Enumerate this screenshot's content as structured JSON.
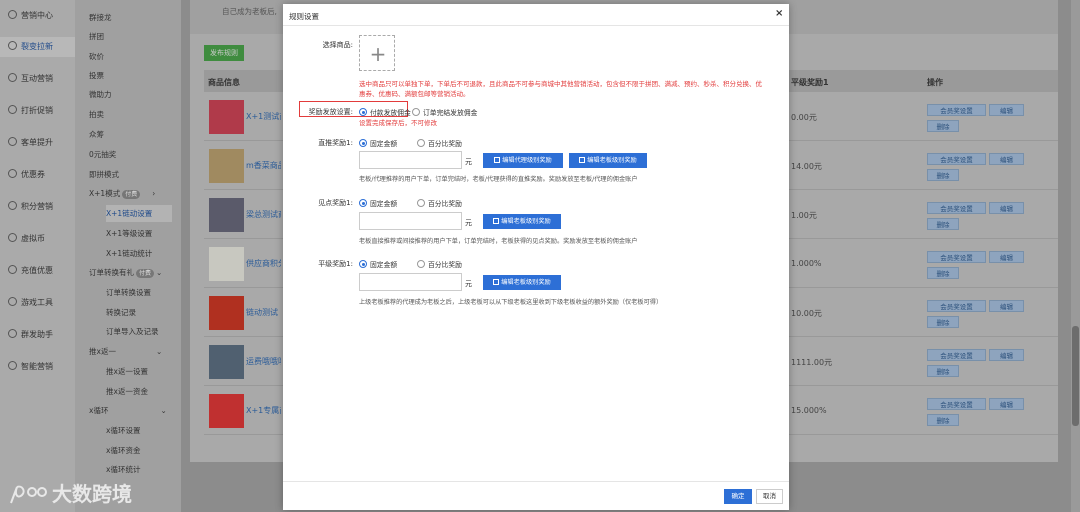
{
  "left_nav": [
    {
      "label": "营销中心",
      "icon": "target-icon"
    },
    {
      "label": "裂变拉新",
      "icon": "fission-icon"
    },
    {
      "label": "互动营销",
      "icon": "interaction-icon"
    },
    {
      "label": "打折促销",
      "icon": "discount-icon"
    },
    {
      "label": "客单提升",
      "icon": "growth-icon"
    },
    {
      "label": "优惠券",
      "icon": "coupon-icon"
    },
    {
      "label": "积分营销",
      "icon": "points-icon"
    },
    {
      "label": "虚拟币",
      "icon": "coin-icon"
    },
    {
      "label": "充值优惠",
      "icon": "recharge-icon"
    },
    {
      "label": "游戏工具",
      "icon": "game-icon"
    },
    {
      "label": "群发助手",
      "icon": "broadcast-icon"
    },
    {
      "label": "智能营销",
      "icon": "smart-icon"
    }
  ],
  "sub_nav": [
    {
      "label": "群接龙",
      "level": 1
    },
    {
      "label": "拼团",
      "level": 1
    },
    {
      "label": "砍价",
      "level": 1
    },
    {
      "label": "投票",
      "level": 1
    },
    {
      "label": "微助力",
      "level": 1
    },
    {
      "label": "拍卖",
      "level": 1
    },
    {
      "label": "众筹",
      "level": 1
    },
    {
      "label": "0元抽奖",
      "level": 1
    },
    {
      "label": "即拼模式",
      "level": 1
    },
    {
      "label": "X+1模式",
      "level": 1,
      "badge": "付费"
    },
    {
      "label": "X+1链动设置",
      "level": 2,
      "active": true
    },
    {
      "label": "X+1等级设置",
      "level": 2
    },
    {
      "label": "X+1链动统计",
      "level": 2
    },
    {
      "label": "订单转换有礼",
      "level": 1,
      "badge": "付费"
    },
    {
      "label": "订单转换设置",
      "level": 2
    },
    {
      "label": "转换记录",
      "level": 2
    },
    {
      "label": "订单导入及记录",
      "level": 2
    },
    {
      "label": "推x返一",
      "level": 1
    },
    {
      "label": "推x返一设置",
      "level": 2
    },
    {
      "label": "推x返一资金",
      "level": 2
    },
    {
      "label": "x循环",
      "level": 1
    },
    {
      "label": "x循环设置",
      "level": 2
    },
    {
      "label": "x循环资金",
      "level": 2
    },
    {
      "label": "x循环统计",
      "level": 2
    }
  ],
  "main": {
    "top_text": "自己成为老板后,",
    "publish_label": "发布规则",
    "col_product": "商品信息",
    "col_reward": "平级奖励1",
    "col_action": "操作",
    "btn_setting": "会员奖设置",
    "btn_edit": "编辑",
    "btn_delete": "删除",
    "rows": [
      {
        "name": "X+1测试商品",
        "reward": "0.00元",
        "thumb_color": "#b03a4a"
      },
      {
        "name": "m香菜商品觉得就到哪",
        "reward": "14.00元",
        "thumb_color": "#a08a60"
      },
      {
        "name": "梁总测试商品",
        "reward": "1.00元",
        "thumb_color": "#5a5a6a"
      },
      {
        "name": "供应商积分",
        "reward": "1.000%",
        "thumb_color": "#c8c8c0"
      },
      {
        "name": "链动测试",
        "reward": "10.00元",
        "thumb_color": "#b03020"
      },
      {
        "name": "运费哦哦哦哦趣哦哦返",
        "reward": "1111.00元",
        "thumb_color": "#506070"
      },
      {
        "name": "X+1专属商品",
        "reward": "15.000%",
        "thumb_color": "#c03030"
      }
    ]
  },
  "watermark": "大数跨境",
  "modal": {
    "title": "规则设置",
    "close": "×",
    "select_goods_label": "选择商品:",
    "upload_plus": "+",
    "warn_line1": "选中商品只可以单独下单，下单后不可退款，且此商品不可参与商城中其他营销活动，包含但不限于拼团、满减、预约、秒杀、积分兑换、优",
    "warn_line2": "惠券、优惠码、满额包邮等营销活动。",
    "reward_setting_label": "奖励发放设置:",
    "reward_opt1": "付款发放佣金",
    "reward_opt2": "订单完结发放佣金",
    "reward_warn": "设置完成保存后，不可修改",
    "direct_label": "直推奖励1:",
    "seen_label": "见点奖励1:",
    "level_label": "平级奖励1:",
    "opt_fixed": "固定金额",
    "opt_percent": "百分比奖励",
    "unit": "元",
    "btn_edit_agent": "编辑代理级别奖励",
    "btn_edit_boss": "编辑老板级别奖励",
    "note_direct": "老板/代理推荐的用户下单，订单完结时，老板/代理获得的直推奖励。奖励发放至老板/代理的佣金账户",
    "note_seen": "老板直接推荐或间接推荐的用户下单，订单完结时，老板获得的见点奖励。奖励发放至老板的佣金账户",
    "note_level": "上级老板推荐的代理成为老板之后，上级老板可以从下级老板这里收到下级老板收益的额外奖励（仅老板可得）",
    "ok": "确定",
    "cancel": "取消"
  }
}
